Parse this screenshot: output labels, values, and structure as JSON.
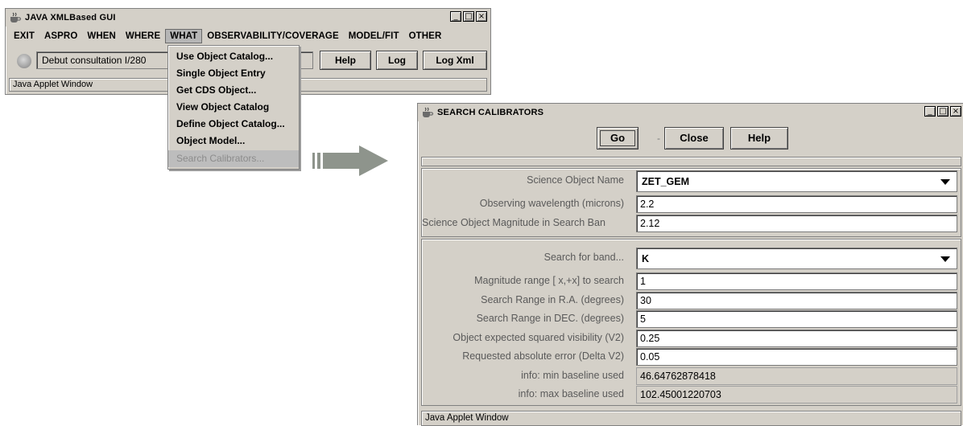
{
  "window1": {
    "title": "JAVA XMLBased GUI",
    "controls": [
      "_",
      "□",
      "×"
    ],
    "menu": [
      "EXIT",
      "ASPRO",
      "WHEN",
      "WHERE",
      "WHAT",
      "OBSERVABILITY/COVERAGE",
      "MODEL/FIT",
      "OTHER"
    ],
    "active_menu": "WHAT",
    "status_text": "Debut consultation I/280",
    "buttons": {
      "help": "Help",
      "log": "Log",
      "log_xml": "Log Xml"
    },
    "applet_status": "Java Applet Window"
  },
  "dropdown": {
    "items": [
      "Use Object Catalog...",
      "Single Object Entry",
      "Get CDS Object...",
      "View Object Catalog",
      "Define Object Catalog...",
      "Object Model...",
      "Search Calibrators..."
    ],
    "disabled_item": "Search Calibrators..."
  },
  "arrow": {
    "icon": "right-arrow-icon",
    "color": "#8e948c"
  },
  "window2": {
    "title": "SEARCH CALIBRATORS",
    "controls": [
      "_",
      "□",
      "×"
    ],
    "buttons": {
      "go": "Go",
      "separator": "-",
      "close": "Close",
      "help": "Help"
    },
    "section1": [
      {
        "label": "Science Object Name",
        "value": "ZET_GEM",
        "kind": "select"
      },
      {
        "label": "Observing wavelength (microns)",
        "value": "2.2",
        "kind": "input"
      },
      {
        "label": "Science Object Magnitude in Search Ban",
        "value": "2.12",
        "kind": "input"
      }
    ],
    "section2": [
      {
        "label": "Search for band...",
        "value": "K",
        "kind": "select"
      },
      {
        "label": "Magnitude range [ x,+x] to search",
        "value": "1",
        "kind": "input"
      },
      {
        "label": "Search Range in R.A. (degrees)",
        "value": "30",
        "kind": "input"
      },
      {
        "label": "Search Range in DEC. (degrees)",
        "value": "5",
        "kind": "input"
      },
      {
        "label": "Object expected squared visibility (V2)",
        "value": "0.25",
        "kind": "input"
      },
      {
        "label": "Requested absolute error (Delta V2)",
        "value": "0.05",
        "kind": "input"
      },
      {
        "label": "info: min baseline used",
        "value": "46.64762878418",
        "kind": "readonly"
      },
      {
        "label": "info: max baseline used",
        "value": "102.45001220703",
        "kind": "readonly"
      }
    ],
    "applet_status": "Java Applet Window"
  }
}
